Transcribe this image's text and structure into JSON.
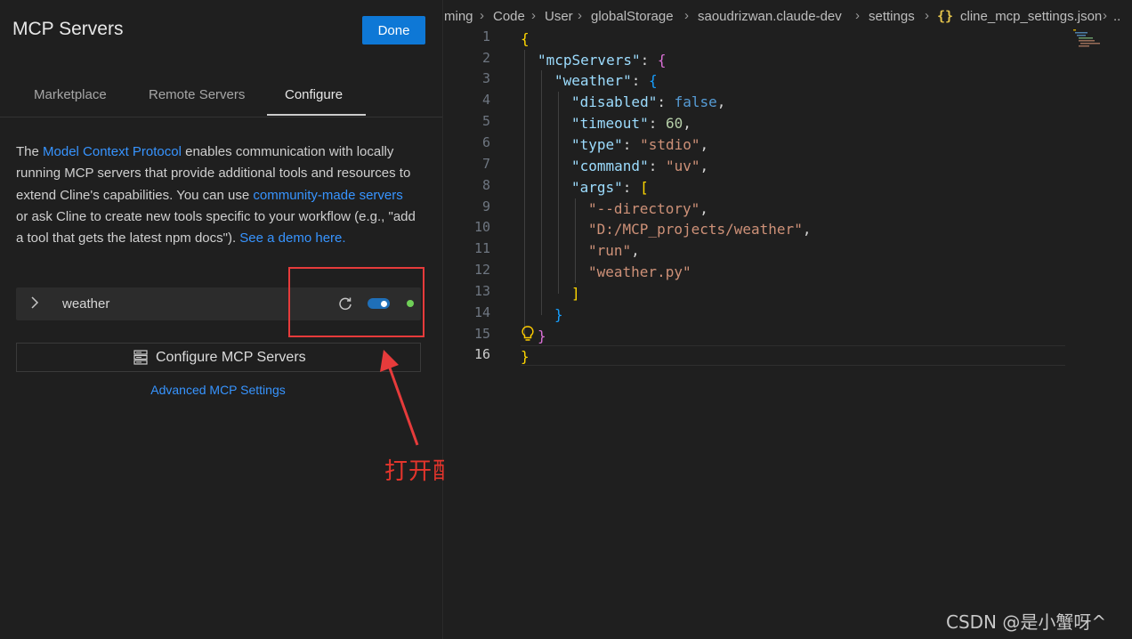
{
  "panel": {
    "title": "MCP Servers",
    "done_label": "Done",
    "tabs": [
      {
        "label": "Marketplace"
      },
      {
        "label": "Remote Servers"
      },
      {
        "label": "Configure"
      }
    ],
    "active_tab": "Configure",
    "description": {
      "t1": "The ",
      "link1": "Model Context Protocol",
      "t2": " enables communication with locally running MCP servers that provide additional tools and resources to extend Cline's capabilities. You can use ",
      "link2": "community-made servers",
      "t3": " or ask Cline to create new tools specific to your workflow (e.g., \"add a tool that gets the latest npm docs\"). ",
      "link3": "See a demo here."
    },
    "server": {
      "name": "weather",
      "enabled": true,
      "status_color": "#6fcf57",
      "icons": [
        "chevron-right-icon",
        "refresh-icon"
      ]
    },
    "configure_label": "Configure MCP Servers",
    "configure_icon": "server-icon",
    "advanced_label": "Advanced MCP Settings"
  },
  "annotation": {
    "text": "打开配置",
    "color": "#e63b3b"
  },
  "editor": {
    "breadcrumb": [
      "ming",
      "Code",
      "User",
      "globalStorage",
      "saoudrizwan.claude-dev",
      "settings",
      "cline_mcp_settings.json",
      ".."
    ],
    "file_icon": "{}",
    "line_numbers": [
      "1",
      "2",
      "3",
      "4",
      "5",
      "6",
      "7",
      "8",
      "9",
      "10",
      "11",
      "12",
      "13",
      "14",
      "15",
      "16"
    ],
    "current_line": "16",
    "code": {
      "open": "{",
      "mcpServers_key": "\"mcpServers\"",
      "weather_key": "\"weather\"",
      "disabled_key": "\"disabled\"",
      "disabled_val": "false",
      "timeout_key": "\"timeout\"",
      "timeout_val": "60",
      "type_key": "\"type\"",
      "type_val": "\"stdio\"",
      "command_key": "\"command\"",
      "command_val": "\"uv\"",
      "args_key": "\"args\"",
      "arg1": "\"--directory\"",
      "arg2": "\"D:/MCP_projects/weather\"",
      "arg3": "\"run\"",
      "arg4": "\"weather.py\""
    }
  },
  "watermark": "CSDN @是小蟹呀^"
}
